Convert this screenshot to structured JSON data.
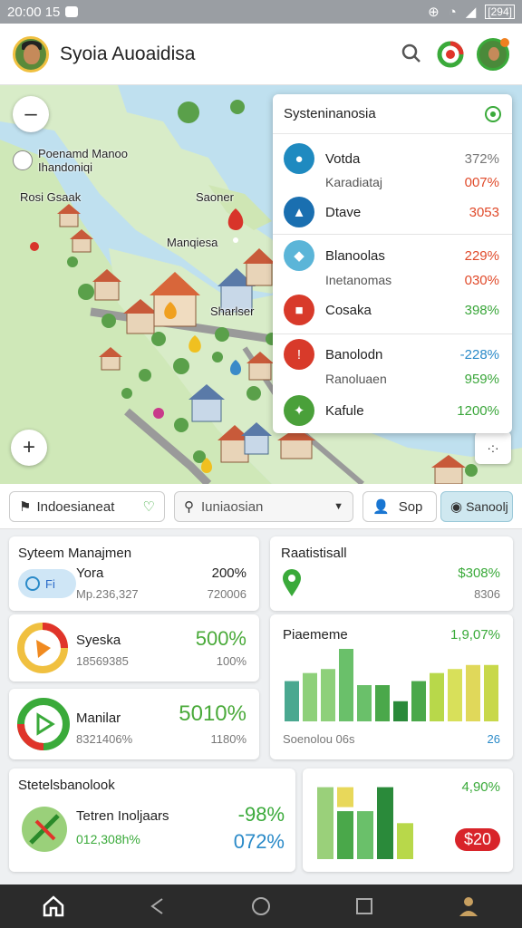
{
  "status_bar": {
    "time": "20:00 15",
    "battery": "[294]"
  },
  "app_bar": {
    "title": "Syoia Auoaidisa"
  },
  "map": {
    "labels": [
      "Poenamd Manoo",
      "Ihandoniqi",
      "Rosi Gsaak",
      "Saoner",
      "Manqiesa",
      "Sharlser"
    ]
  },
  "panel": {
    "title": "Systeninanosia",
    "rows": [
      {
        "name": "Votda",
        "value": "372%",
        "color": "#1f8ac0"
      },
      {
        "name": "Karadiataj",
        "value": "007%",
        "sub": true
      },
      {
        "name": "Dtave",
        "value": "3053",
        "color": "#1a6fb0"
      },
      {
        "name": "Blanoolas",
        "value": "229%",
        "color": "#5bb5d8"
      },
      {
        "name": "Inetanomas",
        "value": "030%",
        "sub": true
      },
      {
        "name": "Cosaka",
        "value": "398%",
        "color": "#d83a2a"
      },
      {
        "name": "Banolodn",
        "value": "-228%",
        "color": "#d83a2a"
      },
      {
        "name": "Ranoluaen",
        "value": "959%",
        "sub": true
      },
      {
        "name": "Kafule",
        "value": "1200%",
        "color": "#4aa03a"
      }
    ]
  },
  "filters": {
    "location": "Indoesianeat",
    "search": "Iuniaosian",
    "user": "Sop",
    "action": "Sanoolj"
  },
  "cards": {
    "system": {
      "title": "Syteem Manajmen",
      "name": "Yora",
      "value": "200%",
      "sub1": "Mp.236,327",
      "sub2": "720006"
    },
    "syeska": {
      "name": "Syeska",
      "value": "500%",
      "sub1": "18569385",
      "sub2": "100%"
    },
    "manilar": {
      "name": "Manilar",
      "value": "5010%",
      "sub1": "8321406%",
      "sub2": "1180%"
    },
    "stats": {
      "title": "Stetelsbanolook",
      "name": "Tetren Inoljaars",
      "value": "-98%",
      "sub": "012,308h%",
      "value2": "072%"
    },
    "registisal": {
      "title": "Raatistisall",
      "value": "$308%",
      "sub": "8306"
    },
    "piaememe": {
      "title": "Piaememe",
      "value": "1,9,07%",
      "footer": "Soenolou 06s",
      "footer_value": "26"
    },
    "bottom_right": {
      "value": "4,90%",
      "badge": "$20"
    }
  },
  "chart_data": [
    {
      "type": "bar",
      "values": [
        5,
        6,
        6.5,
        9,
        4.5,
        4.5,
        2.5,
        5,
        6,
        6.5,
        7,
        7
      ]
    },
    {
      "type": "bar",
      "values": [
        6,
        4,
        4,
        6,
        3
      ]
    }
  ]
}
